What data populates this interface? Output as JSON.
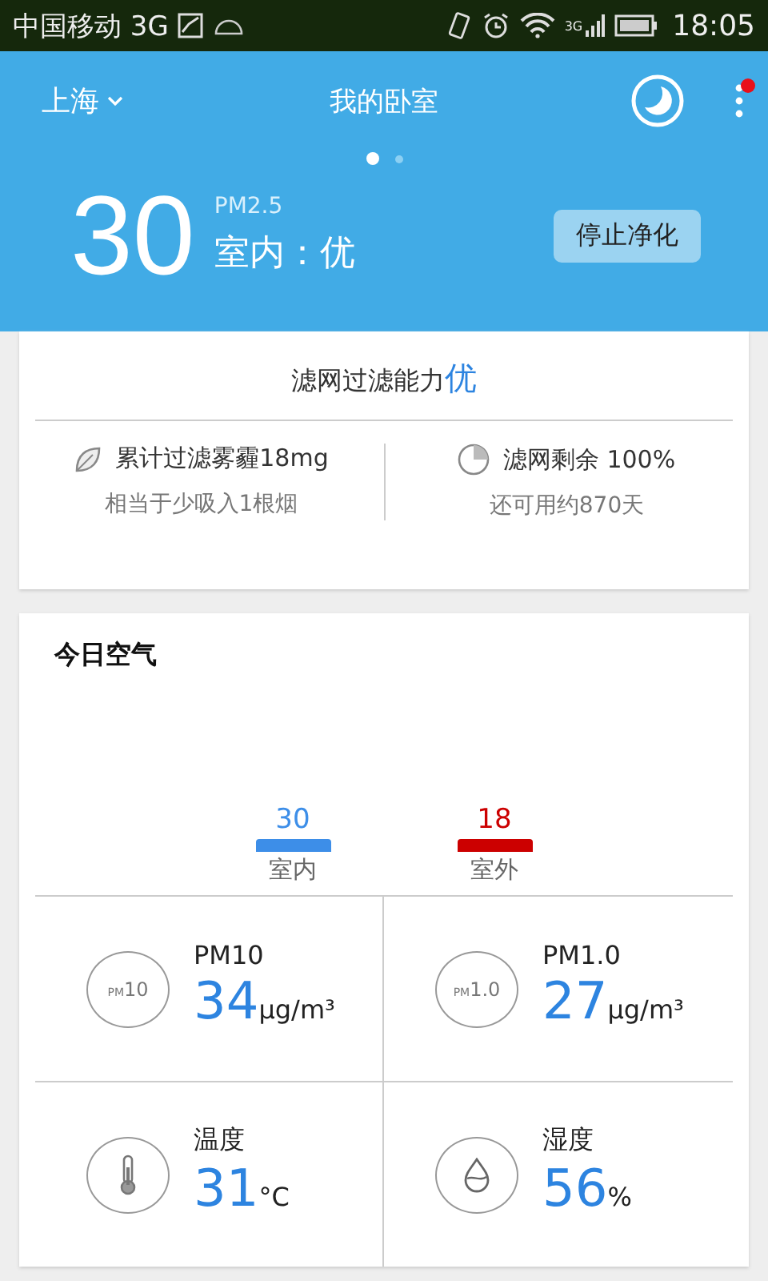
{
  "status_bar": {
    "carrier": "中国移动 3G",
    "network": "3G",
    "time": "18:05"
  },
  "header": {
    "city": "上海",
    "room": "我的卧室",
    "menu_badge": true,
    "pages": [
      {
        "selected": true
      },
      {
        "selected": false
      }
    ],
    "aqi": "30",
    "aqi_label": "PM2.5",
    "status": "室内：优",
    "button": "停止净化"
  },
  "filter": {
    "title": "滤网过滤能力",
    "grade": "优",
    "stats": [
      {
        "kind": "leaf",
        "title": "累计过滤雾霾18mg",
        "note": "相当于少吸入1根烟"
      },
      {
        "kind": "pie",
        "title": "滤网剩余 100%",
        "note": "还可用约870天"
      }
    ]
  },
  "today": {
    "title": "今日空气",
    "comparison": [
      {
        "value": "30",
        "label": "室内",
        "color": "#3d8ee8"
      },
      {
        "value": "18",
        "label": "室外",
        "color": "#cc0000"
      }
    ],
    "metrics": [
      {
        "kind": "pm",
        "icon_prefix": "PM",
        "icon_number": "10",
        "name": "PM10",
        "value": "34",
        "unit": "μg/m³"
      },
      {
        "kind": "pm",
        "icon_prefix": "PM",
        "icon_number": "1.0",
        "name": "PM1.0",
        "value": "27",
        "unit": "μg/m³"
      },
      {
        "kind": "temperature",
        "name": "温度",
        "value": "31",
        "unit": "°C"
      },
      {
        "kind": "humidity",
        "name": "湿度",
        "value": "56",
        "unit": "%"
      }
    ]
  }
}
